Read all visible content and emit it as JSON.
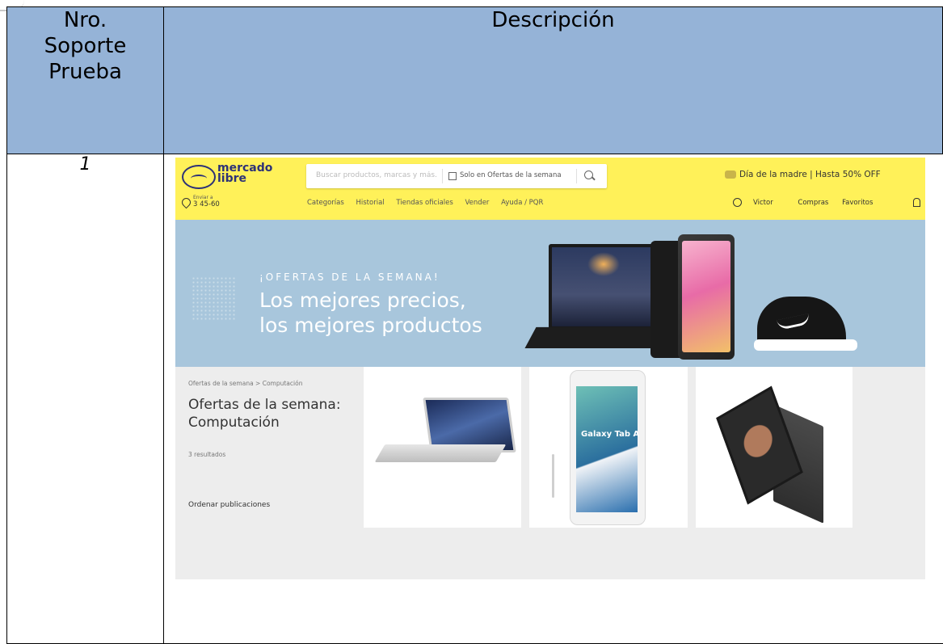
{
  "table": {
    "header": {
      "col1": "Nro.\nSoporte\nPrueba",
      "col2": "Descripción"
    },
    "row": {
      "number": "1"
    }
  },
  "screenshot": {
    "logo": {
      "text": "mercado\nlibre"
    },
    "search": {
      "placeholder": "Buscar productos, marcas y más...",
      "only_offers": "Solo en Ofertas de la semana"
    },
    "promo": "Día de la madre | Hasta 50% OFF",
    "location": {
      "label": "Enviar a",
      "zip": "3 45-60"
    },
    "nav": [
      "Categorías",
      "Historial",
      "Tiendas oficiales",
      "Vender",
      "Ayuda / PQR"
    ],
    "user": [
      "Victor",
      "Compras",
      "Favoritos"
    ],
    "banner": {
      "kicker": "¡OFERTAS DE LA SEMANA!",
      "line1": "Los mejores precios,",
      "line2": "los mejores productos"
    },
    "results": {
      "breadcrumb": "Ofertas de la semana > Computación",
      "title": "Ofertas de la semana: Computación",
      "count": "3 resultados",
      "sort_label": "Ordenar publicaciones"
    },
    "tablet_text": "Galaxy Tab A"
  },
  "colors": {
    "header_blue": "#95b3d7",
    "ml_yellow": "#fff159",
    "banner_blue": "#a8c6dc"
  }
}
